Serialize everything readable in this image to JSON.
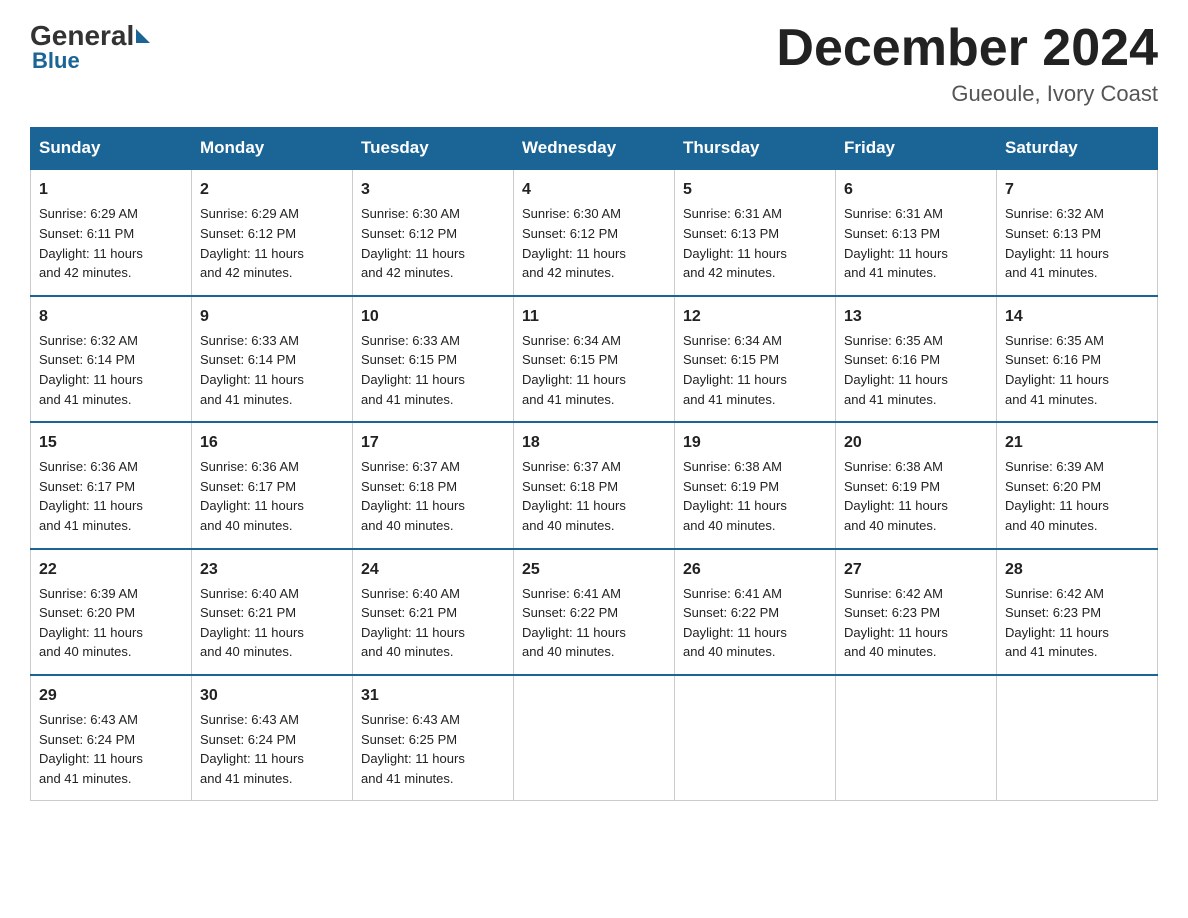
{
  "header": {
    "logo": {
      "general": "General",
      "blue": "Blue"
    },
    "title": "December 2024",
    "location": "Gueoule, Ivory Coast"
  },
  "weekdays": [
    "Sunday",
    "Monday",
    "Tuesday",
    "Wednesday",
    "Thursday",
    "Friday",
    "Saturday"
  ],
  "weeks": [
    [
      {
        "day": "1",
        "sunrise": "6:29 AM",
        "sunset": "6:11 PM",
        "daylight": "11 hours and 42 minutes."
      },
      {
        "day": "2",
        "sunrise": "6:29 AM",
        "sunset": "6:12 PM",
        "daylight": "11 hours and 42 minutes."
      },
      {
        "day": "3",
        "sunrise": "6:30 AM",
        "sunset": "6:12 PM",
        "daylight": "11 hours and 42 minutes."
      },
      {
        "day": "4",
        "sunrise": "6:30 AM",
        "sunset": "6:12 PM",
        "daylight": "11 hours and 42 minutes."
      },
      {
        "day": "5",
        "sunrise": "6:31 AM",
        "sunset": "6:13 PM",
        "daylight": "11 hours and 42 minutes."
      },
      {
        "day": "6",
        "sunrise": "6:31 AM",
        "sunset": "6:13 PM",
        "daylight": "11 hours and 41 minutes."
      },
      {
        "day": "7",
        "sunrise": "6:32 AM",
        "sunset": "6:13 PM",
        "daylight": "11 hours and 41 minutes."
      }
    ],
    [
      {
        "day": "8",
        "sunrise": "6:32 AM",
        "sunset": "6:14 PM",
        "daylight": "11 hours and 41 minutes."
      },
      {
        "day": "9",
        "sunrise": "6:33 AM",
        "sunset": "6:14 PM",
        "daylight": "11 hours and 41 minutes."
      },
      {
        "day": "10",
        "sunrise": "6:33 AM",
        "sunset": "6:15 PM",
        "daylight": "11 hours and 41 minutes."
      },
      {
        "day": "11",
        "sunrise": "6:34 AM",
        "sunset": "6:15 PM",
        "daylight": "11 hours and 41 minutes."
      },
      {
        "day": "12",
        "sunrise": "6:34 AM",
        "sunset": "6:15 PM",
        "daylight": "11 hours and 41 minutes."
      },
      {
        "day": "13",
        "sunrise": "6:35 AM",
        "sunset": "6:16 PM",
        "daylight": "11 hours and 41 minutes."
      },
      {
        "day": "14",
        "sunrise": "6:35 AM",
        "sunset": "6:16 PM",
        "daylight": "11 hours and 41 minutes."
      }
    ],
    [
      {
        "day": "15",
        "sunrise": "6:36 AM",
        "sunset": "6:17 PM",
        "daylight": "11 hours and 41 minutes."
      },
      {
        "day": "16",
        "sunrise": "6:36 AM",
        "sunset": "6:17 PM",
        "daylight": "11 hours and 40 minutes."
      },
      {
        "day": "17",
        "sunrise": "6:37 AM",
        "sunset": "6:18 PM",
        "daylight": "11 hours and 40 minutes."
      },
      {
        "day": "18",
        "sunrise": "6:37 AM",
        "sunset": "6:18 PM",
        "daylight": "11 hours and 40 minutes."
      },
      {
        "day": "19",
        "sunrise": "6:38 AM",
        "sunset": "6:19 PM",
        "daylight": "11 hours and 40 minutes."
      },
      {
        "day": "20",
        "sunrise": "6:38 AM",
        "sunset": "6:19 PM",
        "daylight": "11 hours and 40 minutes."
      },
      {
        "day": "21",
        "sunrise": "6:39 AM",
        "sunset": "6:20 PM",
        "daylight": "11 hours and 40 minutes."
      }
    ],
    [
      {
        "day": "22",
        "sunrise": "6:39 AM",
        "sunset": "6:20 PM",
        "daylight": "11 hours and 40 minutes."
      },
      {
        "day": "23",
        "sunrise": "6:40 AM",
        "sunset": "6:21 PM",
        "daylight": "11 hours and 40 minutes."
      },
      {
        "day": "24",
        "sunrise": "6:40 AM",
        "sunset": "6:21 PM",
        "daylight": "11 hours and 40 minutes."
      },
      {
        "day": "25",
        "sunrise": "6:41 AM",
        "sunset": "6:22 PM",
        "daylight": "11 hours and 40 minutes."
      },
      {
        "day": "26",
        "sunrise": "6:41 AM",
        "sunset": "6:22 PM",
        "daylight": "11 hours and 40 minutes."
      },
      {
        "day": "27",
        "sunrise": "6:42 AM",
        "sunset": "6:23 PM",
        "daylight": "11 hours and 40 minutes."
      },
      {
        "day": "28",
        "sunrise": "6:42 AM",
        "sunset": "6:23 PM",
        "daylight": "11 hours and 41 minutes."
      }
    ],
    [
      {
        "day": "29",
        "sunrise": "6:43 AM",
        "sunset": "6:24 PM",
        "daylight": "11 hours and 41 minutes."
      },
      {
        "day": "30",
        "sunrise": "6:43 AM",
        "sunset": "6:24 PM",
        "daylight": "11 hours and 41 minutes."
      },
      {
        "day": "31",
        "sunrise": "6:43 AM",
        "sunset": "6:25 PM",
        "daylight": "11 hours and 41 minutes."
      },
      null,
      null,
      null,
      null
    ]
  ],
  "labels": {
    "sunrise": "Sunrise:",
    "sunset": "Sunset:",
    "daylight": "Daylight:"
  }
}
